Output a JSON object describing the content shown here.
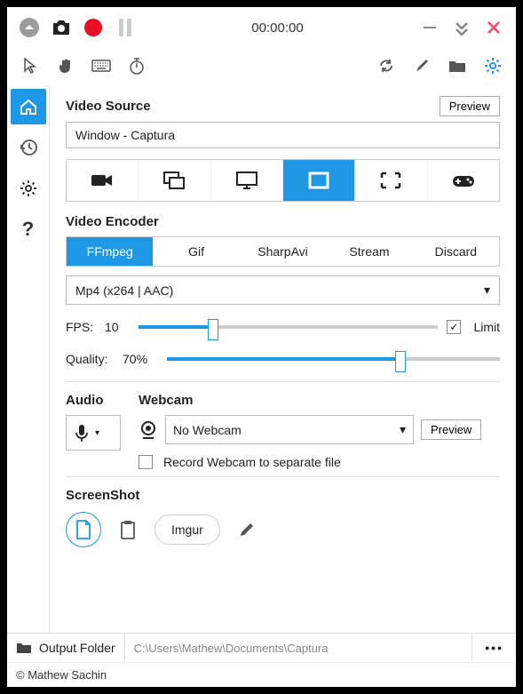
{
  "titlebar": {
    "timer": "00:00:00"
  },
  "videoSource": {
    "title": "Video Source",
    "preview": "Preview",
    "selected": "Window  -  Captura"
  },
  "encoder": {
    "title": "Video Encoder",
    "tabs": [
      "FFmpeg",
      "Gif",
      "SharpAvi",
      "Stream",
      "Discard"
    ],
    "codec": "Mp4 (x264 | AAC)",
    "fpsLabel": "FPS:",
    "fpsValue": "10",
    "limitLabel": "Limit",
    "qualityLabel": "Quality:",
    "qualityValue": "70%"
  },
  "audio": {
    "title": "Audio"
  },
  "webcam": {
    "title": "Webcam",
    "selected": "No Webcam",
    "preview": "Preview",
    "separateLabel": "Record Webcam to separate file"
  },
  "screenshot": {
    "title": "ScreenShot",
    "imgur": "Imgur"
  },
  "footer": {
    "outputLabel": "Output Folder",
    "outputPath": "C:\\Users\\Mathew\\Documents\\Captura",
    "dots": "•••"
  },
  "copyright": "© Mathew Sachin"
}
